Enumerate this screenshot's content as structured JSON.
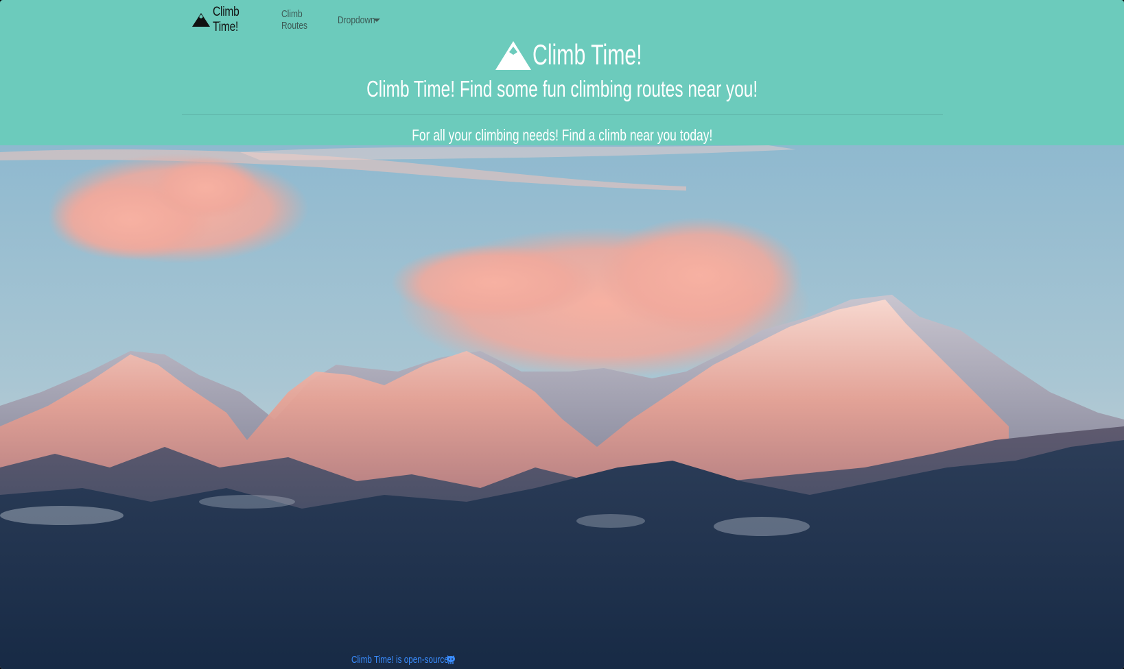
{
  "navbar": {
    "brand_label": "Climb Time!",
    "brand_icon": "mountain-icon",
    "routes_label": "Climb Routes",
    "dropdown_label": "Dropdown",
    "dropdown_icon": "chevron-down-icon"
  },
  "hero": {
    "title": "Climb Time!",
    "title_icon": "mountain-icon",
    "subtitle": "Climb Time! Find some fun climbing routes near you!",
    "tagline": "For all your climbing needs! Find a climb near you today!"
  },
  "footer": {
    "link_text": "Climb Time! is open-source",
    "link_icon": "github-icon"
  },
  "colors": {
    "header_bg": "#6ccbbc",
    "footer_link": "#3a8dff",
    "text_light": "#ffffff",
    "text_dark": "#111111"
  }
}
